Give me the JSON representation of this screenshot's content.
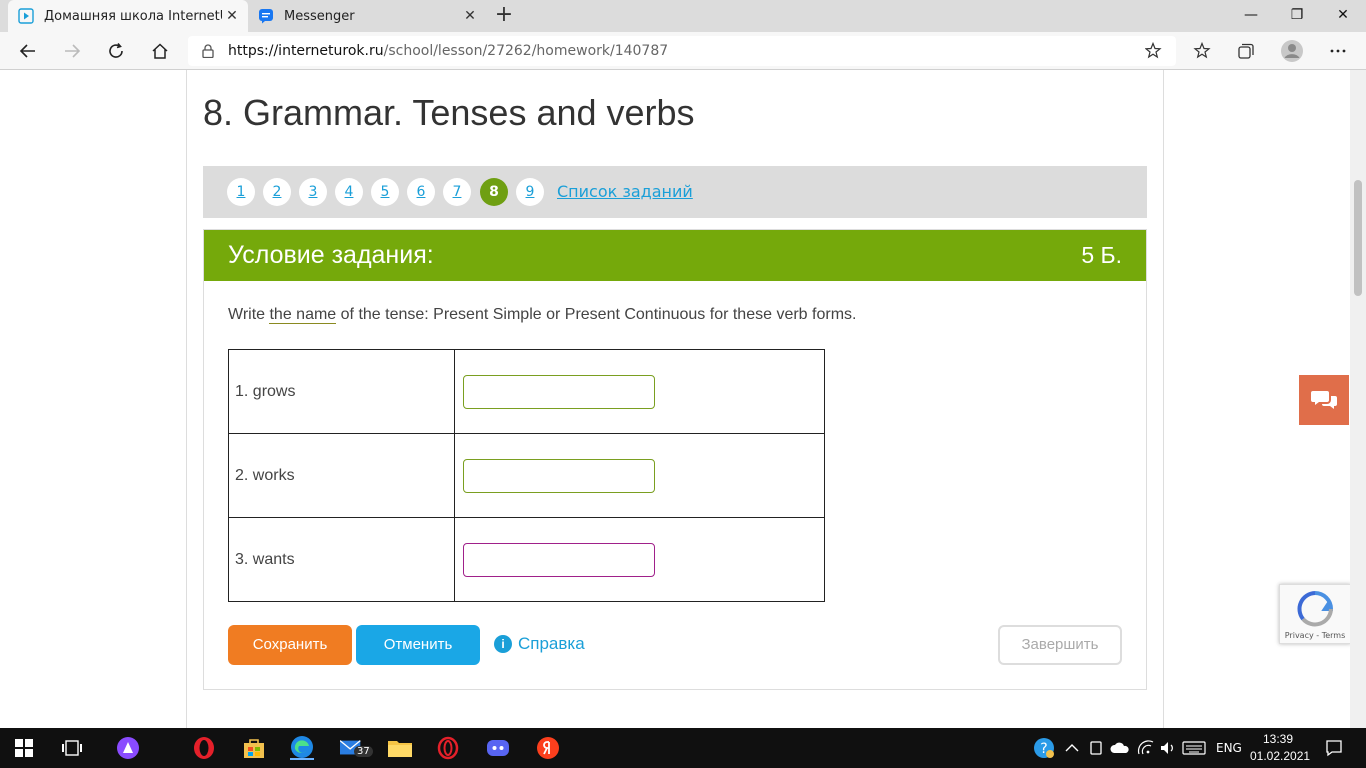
{
  "browser": {
    "tabs": [
      {
        "title": "Домашняя школа InternetUrok.r",
        "active": true
      },
      {
        "title": "Messenger",
        "active": false
      }
    ],
    "url_host": "https://interneturok.ru",
    "url_path": "/school/lesson/27262/homework/140787"
  },
  "lesson": {
    "title": "8. Grammar. Tenses and verbs",
    "pages": [
      "1",
      "2",
      "3",
      "4",
      "5",
      "6",
      "7",
      "8",
      "9"
    ],
    "current_page": "8",
    "tasks_link": "Список заданий"
  },
  "task": {
    "header": "Условие задания:",
    "points": "5 Б.",
    "text_before": "Write ",
    "text_underlined": "the name",
    "text_after": " of the tense: Present Simple or Present Continuous for these verb forms.",
    "rows": [
      {
        "label": "1. grows",
        "value": ""
      },
      {
        "label": "2. works",
        "value": ""
      },
      {
        "label": "3. wants",
        "value": ""
      }
    ],
    "save_label": "Сохранить",
    "cancel_label": "Отменить",
    "help_label": "Справка",
    "finish_label": "Завершить"
  },
  "recaptcha": {
    "text": "Privacy - Terms"
  },
  "taskbar": {
    "mail_badge": "37",
    "lang": "ENG",
    "time": "13:39",
    "date": "01.02.2021"
  },
  "colors": {
    "accent_green": "#75a90b",
    "save_orange": "#f07c22",
    "cancel_blue": "#1aa7e6",
    "link_blue": "#1a9fd8"
  }
}
